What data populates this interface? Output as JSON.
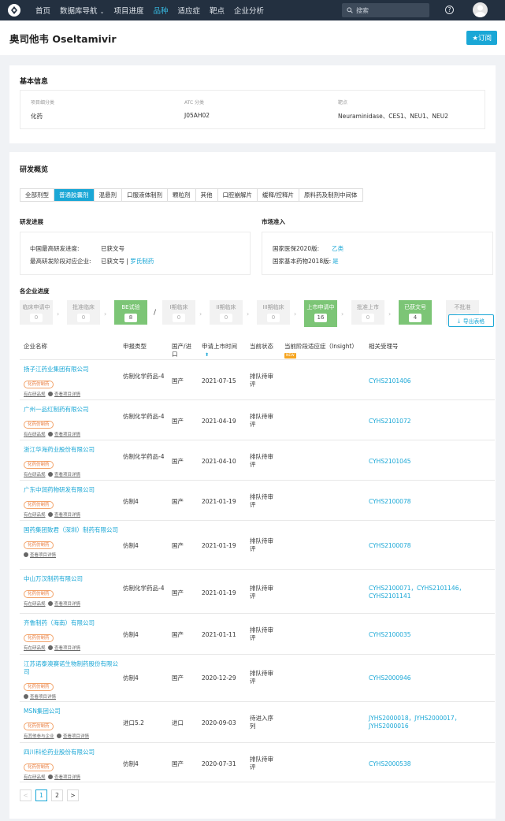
{
  "nav": {
    "items": [
      "首页",
      "数据库导航",
      "项目进度",
      "品种",
      "适应症",
      "靶点",
      "企业分析"
    ],
    "active_index": 3,
    "search_placeholder": "搜索",
    "help": "?"
  },
  "page": {
    "title": "奥司他韦 Oseltamivir",
    "subscribe_label": "★订阅"
  },
  "basic": {
    "title": "基本信息",
    "fields": [
      {
        "label": "项目细分类",
        "value": "化药"
      },
      {
        "label": "ATC 分类",
        "value": "J05AH02"
      },
      {
        "label": "靶点",
        "value": "Neuraminidase、CES1、NEU1、NEU2"
      }
    ]
  },
  "overview": {
    "title": "研发概览",
    "tabs": [
      "全部剂型",
      "普通胶囊剂",
      "混悬剂",
      "口服液体制剂",
      "颗粒剂",
      "其他",
      "口腔崩解片",
      "缓释/控释片",
      "原料药及制剂中间体"
    ],
    "active_tab": 1,
    "progress": {
      "title": "研发进展",
      "rows": [
        {
          "label": "中国最高研发进度:",
          "value": "已获文号"
        },
        {
          "label": "最高研发阶段对应企业:",
          "value": "已获文号",
          "sep": " | ",
          "link": "罗氏制药"
        }
      ]
    },
    "market": {
      "title": "市场准入",
      "rows": [
        {
          "label": "国家医保2020版:",
          "link": "乙类"
        },
        {
          "label": "国家基本药物2018版:",
          "link": "是"
        }
      ]
    }
  },
  "pipeline": {
    "title": "各企业进度",
    "stages": [
      {
        "label": "临床申请中",
        "count": "0",
        "green": false
      },
      {
        "label": "批准临床",
        "count": "0",
        "green": false
      },
      {
        "label": "BE试验",
        "count": "8",
        "green": true
      },
      {
        "label": "I期临床",
        "count": "0",
        "green": false
      },
      {
        "label": "II期临床",
        "count": "0",
        "green": false
      },
      {
        "label": "III期临床",
        "count": "0",
        "green": false
      },
      {
        "label": "上市申请中",
        "count": "16",
        "green": true
      },
      {
        "label": "批准上市",
        "count": "0",
        "green": false
      },
      {
        "label": "已获文号",
        "count": "4",
        "green": true
      },
      {
        "label": "不批准",
        "count": "0",
        "green": false
      }
    ],
    "separator": "/",
    "export_label": "导出表格"
  },
  "table": {
    "headers": {
      "company": "企业名称",
      "type": "申报类型",
      "origin": "国产/进口",
      "date": "申请上市时间",
      "status": "当前状态",
      "indication": "当前阶段适应症（Insight）",
      "new_tag": "NEW",
      "acceptance": "相关受理号"
    },
    "rows": [
      {
        "company": "扬子江药业集团有限公司",
        "tag": "化药仿制药",
        "link1": "有在研品规",
        "link2": "查看项目详情",
        "type": "仿制化学药品-4",
        "origin": "国产",
        "date": "2021-07-15",
        "status": "排队待审评",
        "acceptance": "CYHS2101406"
      },
      {
        "company": "广州一品红制药有限公司",
        "tag": "化药仿制药",
        "link1": "有在研品规",
        "link2": "查看项目详情",
        "type": "仿制化学药品-4",
        "origin": "国产",
        "date": "2021-04-19",
        "status": "排队待审评",
        "acceptance": "CYHS2101072"
      },
      {
        "company": "浙江华海药业股份有限公司",
        "tag": "化药仿制药",
        "link1": "有在研品规",
        "link2": "查看项目详情",
        "type": "仿制化学药品-4",
        "origin": "国产",
        "date": "2021-04-10",
        "status": "排队待审评",
        "acceptance": "CYHS2101045"
      },
      {
        "company": "广东中润药物研发有限公司",
        "tag": "化药仿制药",
        "link1": "有在研品规",
        "link2": "查看项目详情",
        "type": "仿制4",
        "origin": "国产",
        "date": "2021-01-19",
        "status": "排队待审评",
        "acceptance": "CYHS2100078"
      },
      {
        "company": "国药集团致君（深圳）制药有限公司",
        "tag": "化药仿制药",
        "link1": "",
        "link2": "查看项目详情",
        "type": "仿制4",
        "origin": "国产",
        "date": "2021-01-19",
        "status": "排队待审评",
        "acceptance": "CYHS2100078"
      },
      {
        "company": "中山万汉制药有限公司",
        "tag": "化药仿制药",
        "link1": "有在研品规",
        "link2": "查看项目详情",
        "type": "仿制化学药品-4",
        "origin": "国产",
        "date": "2021-01-19",
        "status": "排队待审评",
        "acceptance": "CYHS2100071，CYHS2101146，CYHS2101141"
      },
      {
        "company": "齐鲁制药（海南）有限公司",
        "tag": "化药仿制药",
        "link1": "有在研品规",
        "link2": "查看项目详情",
        "type": "仿制4",
        "origin": "国产",
        "date": "2021-01-11",
        "status": "排队待审评",
        "acceptance": "CYHS2100035"
      },
      {
        "company": "江苏诺泰澳赛诺生物制药股份有限公司",
        "tag": "化药仿制药",
        "link1": "",
        "link2": "查看项目详情",
        "type": "仿制4",
        "origin": "国产",
        "date": "2020-12-29",
        "status": "排队待审评",
        "acceptance": "CYHS2000946"
      },
      {
        "company": "MSN集团公司",
        "tag": "化药仿制药",
        "link1": "有其他参与企业",
        "link2": "查看项目详情",
        "type": "进口5.2",
        "origin": "进口",
        "date": "2020-09-03",
        "status": "待进入序列",
        "acceptance": "JYHS2000018，JYHS2000017，JYHS2000016"
      },
      {
        "company": "四川科伦药业股份有限公司",
        "tag": "化药仿制药",
        "link1": "有在研品规",
        "link2": "查看项目详情",
        "type": "仿制4",
        "origin": "国产",
        "date": "2020-07-31",
        "status": "排队待审评",
        "acceptance": "CYHS2000538"
      }
    ]
  },
  "pager": {
    "prev": "<",
    "pages": [
      "1",
      "2"
    ],
    "next": ">"
  }
}
